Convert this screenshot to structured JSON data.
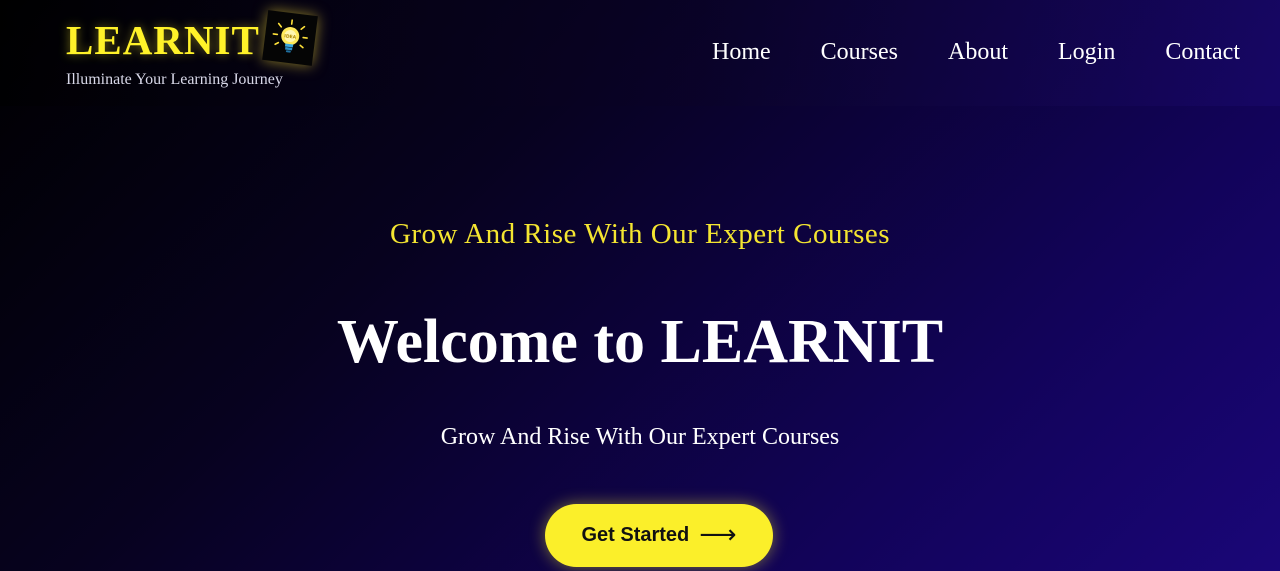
{
  "brand": {
    "name": "LEARNIT",
    "tagline": "Illuminate Your Learning Journey",
    "logo_icon": "lightbulb-icon",
    "logo_text": "IDEA"
  },
  "nav": {
    "items": [
      {
        "label": "Home"
      },
      {
        "label": "Courses"
      },
      {
        "label": "About"
      },
      {
        "label": "Login"
      },
      {
        "label": "Contact"
      }
    ]
  },
  "hero": {
    "subtitle": "Grow And Rise With Our Expert Courses",
    "title": "Welcome to LEARNIT",
    "text": "Grow And Rise With Our Expert Courses",
    "cta_label": "Get Started",
    "cta_icon": "arrow-right-icon",
    "cta_arrow": "⟶"
  },
  "colors": {
    "accent_yellow": "#fbef2a",
    "background_dark": "#000000",
    "background_purple": "#1a0678",
    "text_white": "#ffffff"
  }
}
